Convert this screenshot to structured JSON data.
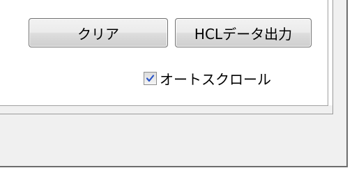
{
  "toolbar": {
    "clear_label": "クリア",
    "export_label": "HCLデータ出力"
  },
  "options": {
    "autoscroll_label": "オートスクロール",
    "autoscroll_checked": true
  },
  "colors": {
    "checkmark": "#2a55c8"
  }
}
